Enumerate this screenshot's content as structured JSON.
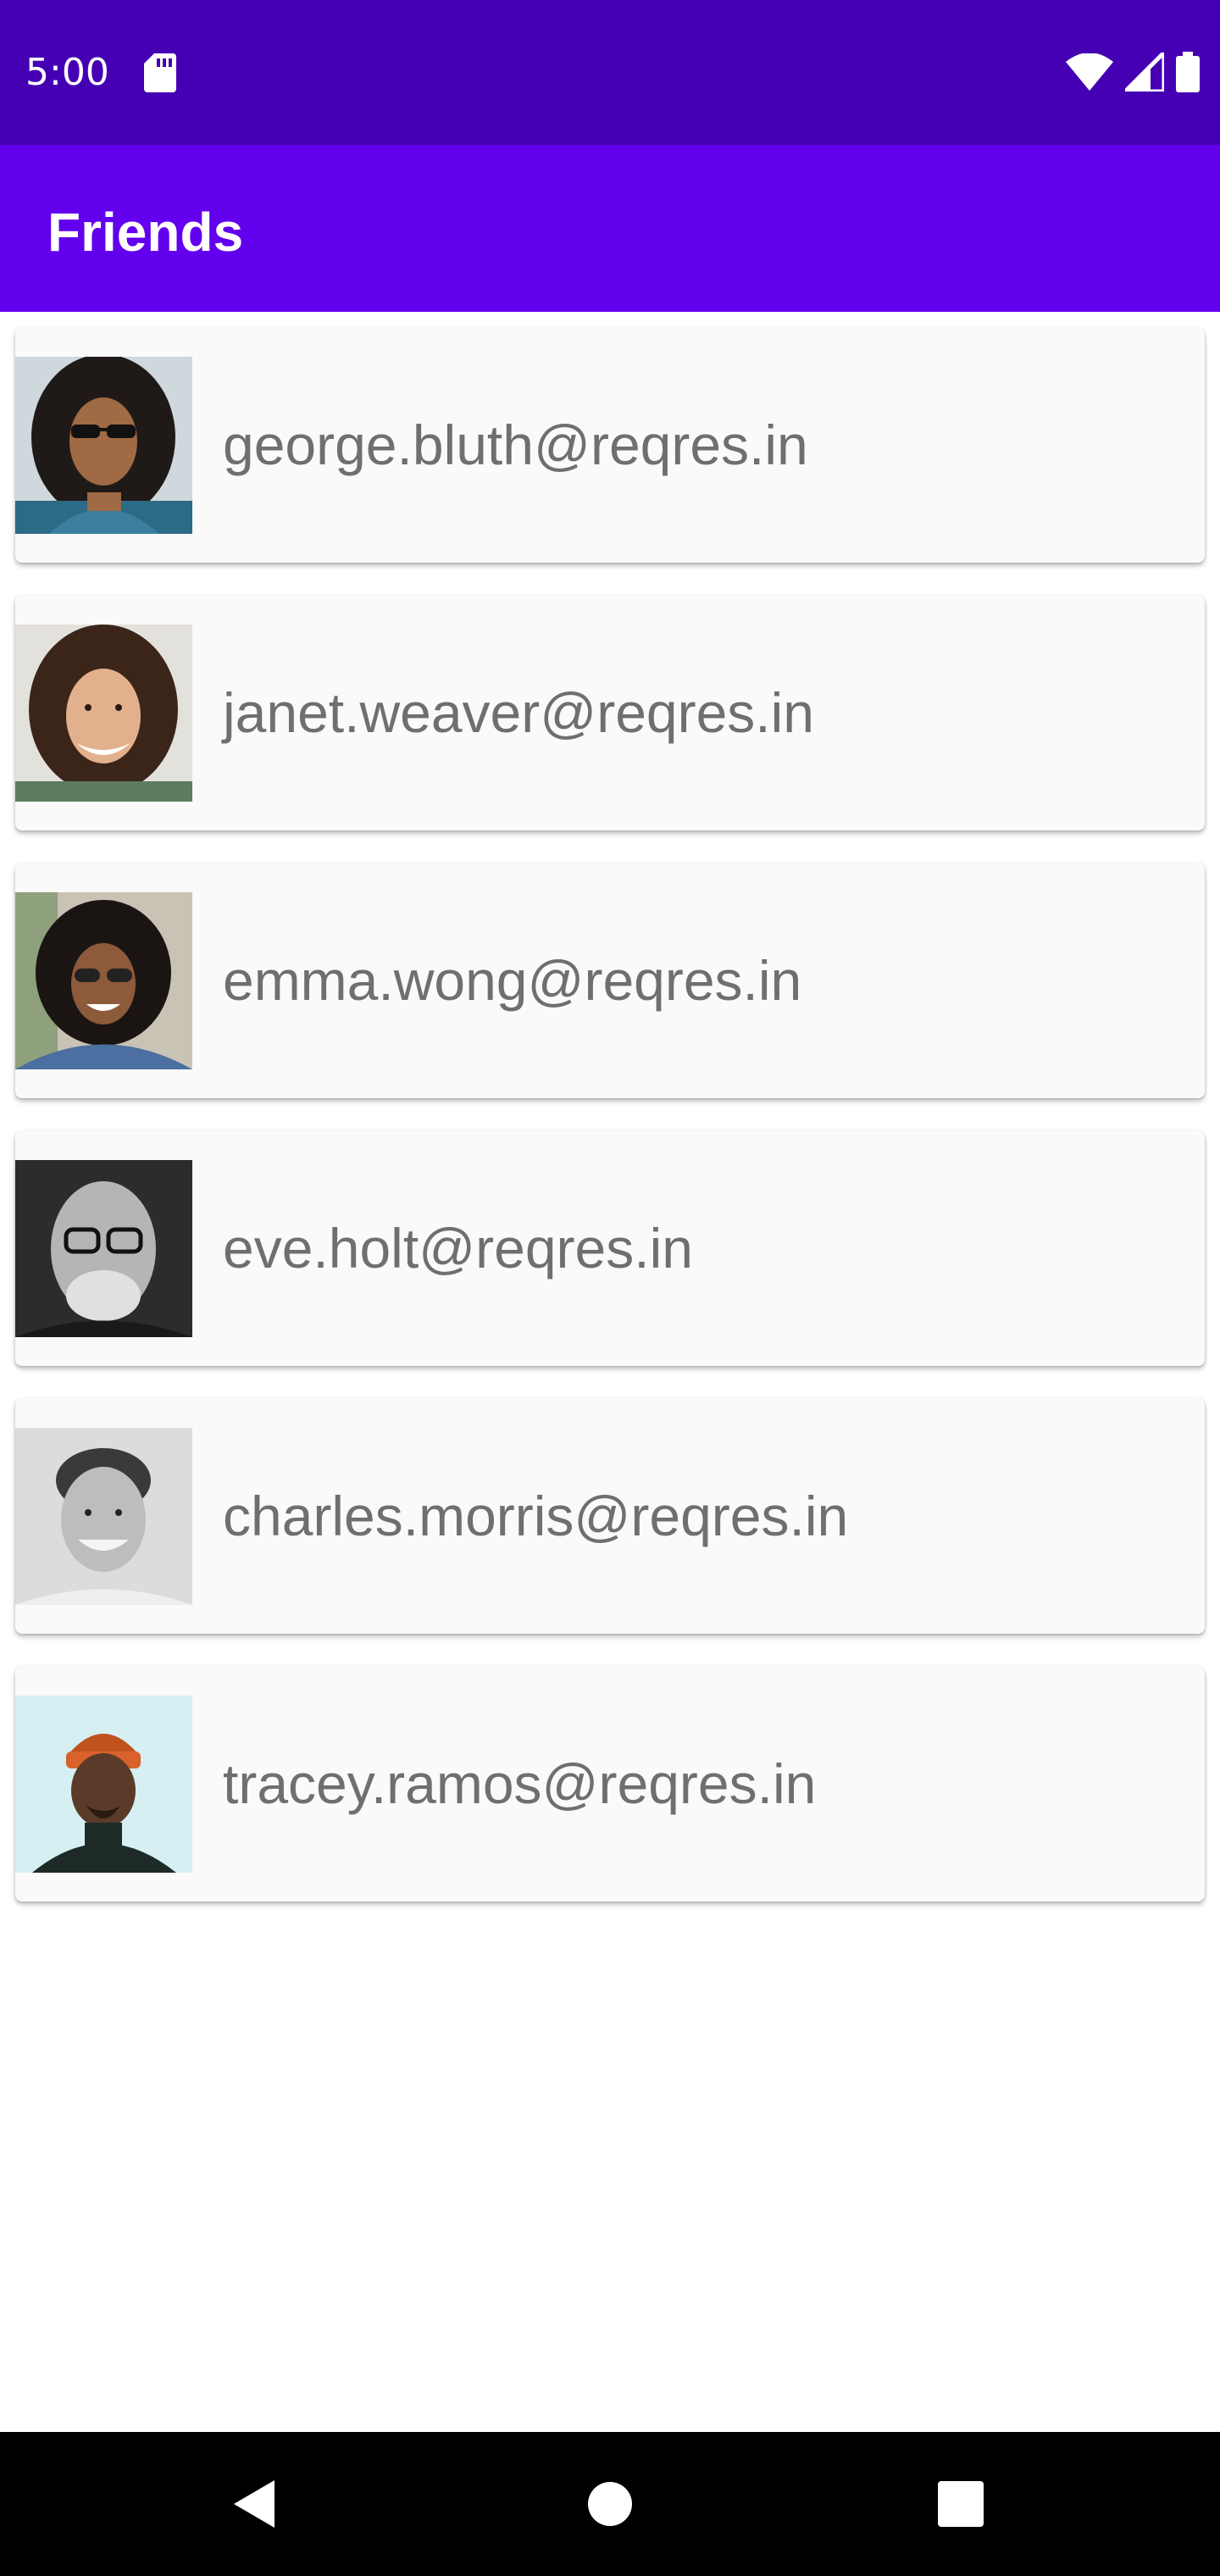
{
  "status_bar": {
    "time": "5:00",
    "icons": [
      "sd-card-icon",
      "wifi-icon",
      "cell-signal-icon",
      "battery-icon"
    ]
  },
  "app_bar": {
    "title": "Friends"
  },
  "friends": [
    {
      "email": "george.bluth@reqres.in"
    },
    {
      "email": "janet.weaver@reqres.in"
    },
    {
      "email": "emma.wong@reqres.in"
    },
    {
      "email": "eve.holt@reqres.in"
    },
    {
      "email": "charles.morris@reqres.in"
    },
    {
      "email": "tracey.ramos@reqres.in"
    }
  ],
  "nav_bar": {
    "icons": [
      "back-icon",
      "home-icon",
      "recents-icon"
    ]
  },
  "colors": {
    "status_bar": "#4500b4",
    "app_bar": "#6200ee",
    "card_background": "#fafafa",
    "email_text": "#6f6f6f"
  }
}
